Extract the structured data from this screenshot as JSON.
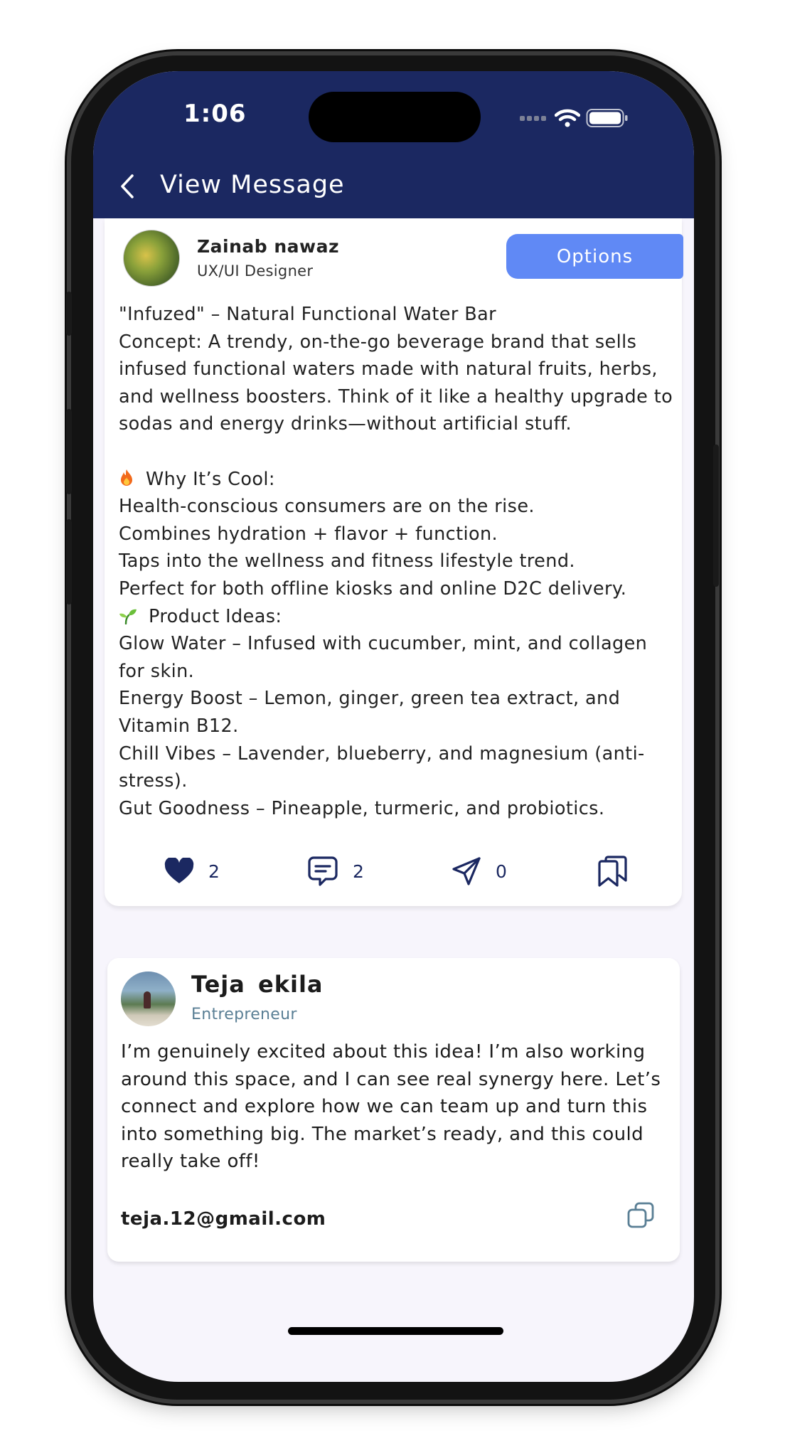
{
  "status_bar": {
    "time": "1:06"
  },
  "header": {
    "title": "View Message"
  },
  "post": {
    "author_name": "Zainab nawaz",
    "author_role": "UX/UI Designer",
    "options_label": "Options",
    "lines": {
      "l1": "\"Infuzed\" – Natural Functional Water Bar",
      "l2": "Concept: A trendy, on-the-go beverage brand that sells",
      "l3": "infused functional waters made with natural fruits, herbs,",
      "l4": "and wellness boosters. Think of it like a healthy upgrade to",
      "l5": "sodas and energy drinks—without artificial stuff.",
      "l6": "Why It’s Cool:",
      "l7": "Health-conscious consumers are on the rise.",
      "l8": "Combines hydration + flavor + function.",
      "l9": "Taps into the wellness and fitness lifestyle trend.",
      "l10": "Perfect for both offline kiosks and online D2C delivery.",
      "l11": "Product Ideas:",
      "l12": "Glow Water – Infused with cucumber, mint, and collagen",
      "l13": "for skin.",
      "l14": "Energy Boost – Lemon, ginger, green tea extract, and",
      "l15": "Vitamin B12.",
      "l16": "Chill Vibes – Lavender, blueberry, and magnesium (anti-",
      "l17": "stress).",
      "l18": "Gut Goodness – Pineapple, turmeric, and probiotics."
    },
    "likes": "2",
    "comments": "2",
    "shares": "0",
    "icons": [
      "heart-icon",
      "comment-icon",
      "send-icon",
      "bookmark-icon"
    ]
  },
  "reply": {
    "author_name": "Teja  ekila",
    "author_role": "Entrepreneur",
    "lines": {
      "l1": "I’m genuinely excited about this idea! I’m also working",
      "l2": "around this space, and I can see real synergy here. Let’s",
      "l3": "connect and explore how we can team up and turn this",
      "l4": "into something big. The market’s ready, and this could",
      "l5": "really take off!"
    },
    "email": "teja.12@gmail.com",
    "copy_icon": "copy-icon"
  },
  "colors": {
    "header_bg": "#1b2861",
    "accent": "#6089f5",
    "background": "#f7f5fc",
    "role_text": "#5a7f95"
  }
}
